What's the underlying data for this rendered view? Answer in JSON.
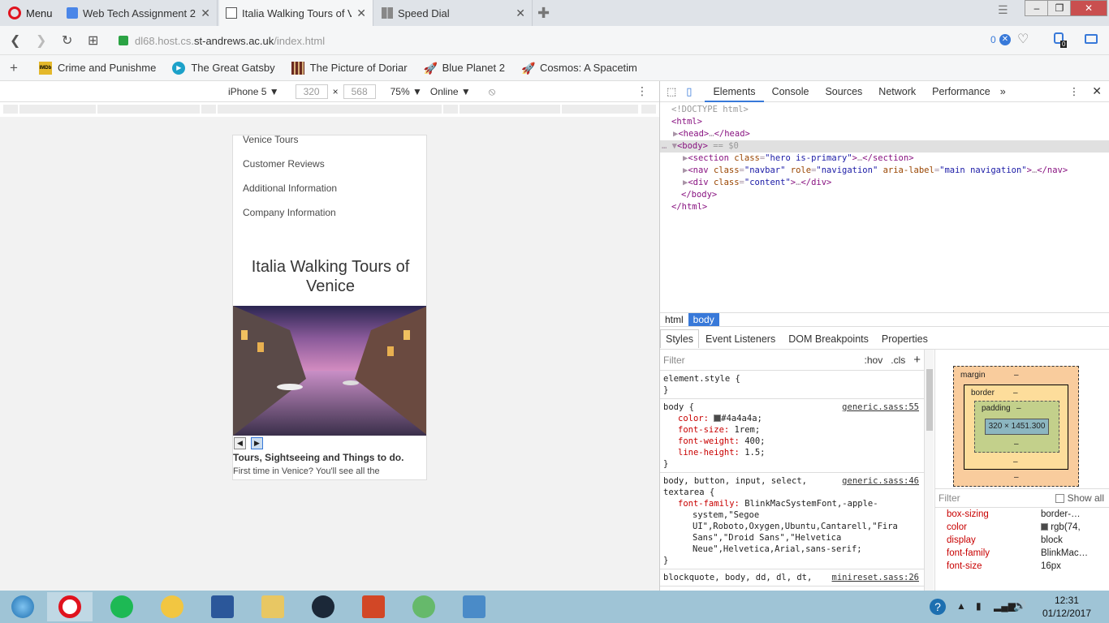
{
  "browser": {
    "menu_label": "Menu",
    "tabs": [
      {
        "title": "Web Tech Assignment 2 -",
        "icon": "docs-icon"
      },
      {
        "title": "Italia Walking Tours of Ven",
        "icon": "page-icon"
      },
      {
        "title": "Speed Dial",
        "icon": "speed-dial-icon"
      }
    ],
    "url_prefix": "dl68.host.cs.",
    "url_main": "st-andrews.ac.uk",
    "url_path": "/index.html",
    "adblock_count": "0",
    "vpn_badge": "0"
  },
  "bookmarks": [
    {
      "label": "Crime and Punishme",
      "icon": "imdb-icon"
    },
    {
      "label": "The Great Gatsby",
      "icon": "play-icon"
    },
    {
      "label": "The Picture of Doriar",
      "icon": "film-icon"
    },
    {
      "label": "Blue Planet 2",
      "icon": "rocket-icon"
    },
    {
      "label": "Cosmos: A Spacetim",
      "icon": "rocket-icon"
    }
  ],
  "device_toolbar": {
    "device": "iPhone 5",
    "width": "320",
    "height": "568",
    "zoom": "75%",
    "network": "Online"
  },
  "site": {
    "nav_items": [
      "Venice Tours",
      "Customer Reviews",
      "Additional Information",
      "Company Information"
    ],
    "hero_title": "Italia Walking Tours of Venice",
    "content_heading": "Tours, Sightseeing and Things to do.",
    "content_text": "First time in Venice? You'll see all the"
  },
  "devtools": {
    "tabs": [
      "Elements",
      "Console",
      "Sources",
      "Network",
      "Performance"
    ],
    "breadcrumbs": [
      "html",
      "body"
    ],
    "sub_tabs": [
      "Styles",
      "Event Listeners",
      "DOM Breakpoints",
      "Properties"
    ],
    "filter_placeholder": "Filter",
    "hov": ":hov",
    "cls": ".cls",
    "box_model": {
      "margin": "margin",
      "border": "border",
      "padding": "padding",
      "content": "320 × 1451.300",
      "dash": "–"
    },
    "show_all": "Show all",
    "computed": [
      {
        "prop": "box-sizing",
        "val": "border-…"
      },
      {
        "prop": "color",
        "val": "rgb(74,"
      },
      {
        "prop": "display",
        "val": "block"
      },
      {
        "prop": "font-family",
        "val": "BlinkMac…"
      },
      {
        "prop": "font-size",
        "val": "16px"
      }
    ]
  },
  "taskbar": {
    "time": "12:31",
    "date": "01/12/2017"
  },
  "colors": {
    "accent": "#3879d9",
    "opera_red": "#e0131e",
    "body_text": "#4a4a4a"
  }
}
